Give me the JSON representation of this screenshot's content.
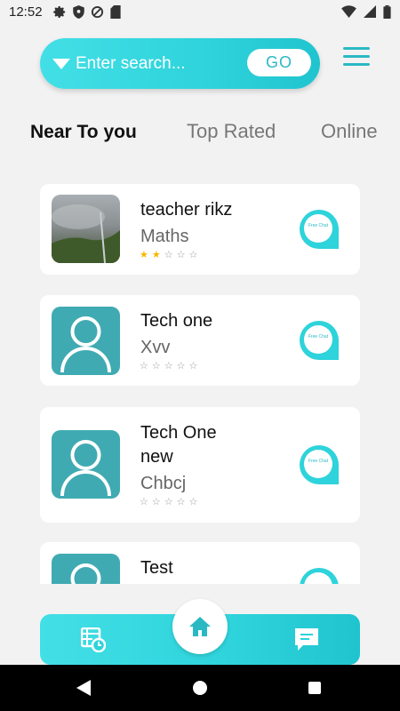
{
  "status_bar": {
    "time": "12:52"
  },
  "search": {
    "placeholder": "Enter search...",
    "go_label": "GO"
  },
  "tabs": [
    {
      "label": "Near To you",
      "active": true
    },
    {
      "label": "Top Rated",
      "active": false
    },
    {
      "label": "Online",
      "active": false
    }
  ],
  "teachers": [
    {
      "name": "teacher rikz",
      "subject": "Maths",
      "rating": 2,
      "avatar": "photo"
    },
    {
      "name": "Tech one",
      "subject": "Xvv",
      "rating": 0,
      "avatar": "default-user-icon"
    },
    {
      "name": "Tech One new",
      "subject": "Chbcj",
      "rating": 0,
      "avatar": "default-user-icon"
    },
    {
      "name": "Test",
      "subject": "",
      "rating": 0,
      "avatar": "default-user-icon"
    }
  ],
  "chat_icon_text": "Free Chat",
  "colors": {
    "accent": "#2ed3db",
    "accent_dark": "#2ab9c3",
    "avatar_bg": "#40aab2",
    "star_on": "#f5b800"
  },
  "bottom_nav": [
    "schedule-icon",
    "home-icon",
    "chat-icon"
  ]
}
